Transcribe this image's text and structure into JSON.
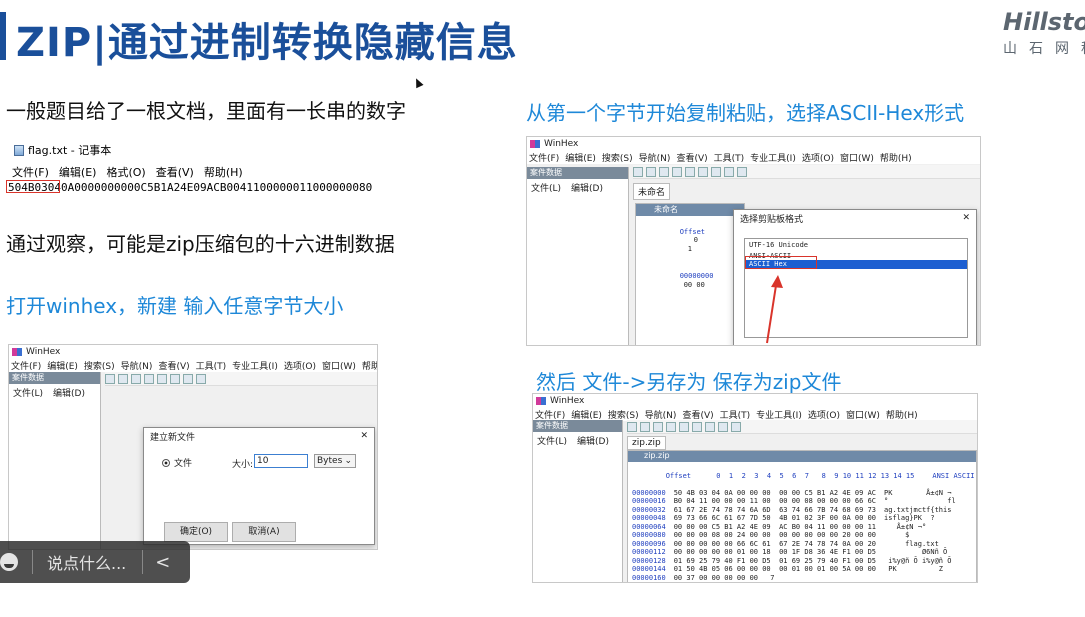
{
  "slide": {
    "title": "ZIP|通过进制转换隐藏信息",
    "logo_en": "Hillstone",
    "logo_cn": "山石网科"
  },
  "left": {
    "text1": "一般题目给了一根文档，里面有一长串的数字",
    "text2": "通过观察，可能是zip压缩包的十六进制数据",
    "text3": "打开winhex，新建 输入任意字节大小"
  },
  "notepad": {
    "title": "flag.txt - 记事本",
    "menu": [
      "文件(F)",
      "编辑(E)",
      "格式(O)",
      "查看(V)",
      "帮助(H)"
    ],
    "content": "504B03040A0000000000C5B1A24E09ACB0041100000011000000080"
  },
  "winhex_common": {
    "app_title": "WinHex",
    "menu": [
      "文件(F)",
      "编辑(E)",
      "搜索(S)",
      "导航(N)",
      "查看(V)",
      "工具(T)",
      "专业工具(I)",
      "选项(O)",
      "窗口(W)",
      "帮助(H)"
    ],
    "case_data": "案件数据",
    "file_tab": "文件(L)",
    "edit_tab": "编辑(D)"
  },
  "new_file_dialog": {
    "title": "建立新文件",
    "option_file": "文件",
    "size_label": "大小:",
    "size_value": "10",
    "unit": "Bytes",
    "ok": "确定(O)",
    "cancel": "取消(A)"
  },
  "right": {
    "text1": "从第一个字节开始复制粘贴，选择ASCII-Hex形式",
    "text2": "然后 文件->另存为  保存为zip文件"
  },
  "clipboard": {
    "doc_tab": "未命名",
    "inner_title": "未命名",
    "offset_header": "Offset",
    "col0": "0",
    "col1": "1",
    "offset_row": "00000000",
    "cells": "00 00",
    "dialog_title": "选择剪贴板格式",
    "options": [
      "UTF-16 Unicode",
      "ANSI-ASCII",
      "ASCII Hex"
    ]
  },
  "zipwin": {
    "doc_tab": "zip.zip",
    "inner_title": "zip.zip",
    "header": "Offset      0  1  2  3  4  5  6  7   8  9 10 11 12 13 14 15",
    "ascii_header": "ANSI ASCII",
    "rows": [
      {
        "off": "00000000",
        "hex": "50 4B 03 04 0A 00 00 00  00 00 C5 B1 A2 4E 09 AC",
        "asc": "PK        Å±¢N ¬"
      },
      {
        "off": "00000016",
        "hex": "B0 04 11 00 00 00 11 00  00 00 08 00 00 00 66 6C",
        "asc": "°              fl"
      },
      {
        "off": "00000032",
        "hex": "61 67 2E 74 78 74 6A 6D  63 74 66 7B 74 68 69 73",
        "asc": "ag.txtjmctf{this"
      },
      {
        "off": "00000048",
        "hex": "69 73 66 6C 61 67 7D 50  4B 01 02 3F 00 0A 00 00",
        "asc": "isflag}PK  ?"
      },
      {
        "off": "00000064",
        "hex": "00 00 00 C5 B1 A2 4E 09  AC B0 04 11 00 00 00 11",
        "asc": "   Å±¢N ¬°"
      },
      {
        "off": "00000080",
        "hex": "00 00 00 08 00 24 00 00  00 00 00 00 00 20 00 00",
        "asc": "     $"
      },
      {
        "off": "00000096",
        "hex": "00 00 00 00 00 66 6C 61  67 2E 74 78 74 0A 00 20",
        "asc": "     flag.txt"
      },
      {
        "off": "00000112",
        "hex": "00 00 00 00 00 01 00 18  00 1F D8 36 4E F1 00 D5",
        "asc": "         Ø6Nñ Õ"
      },
      {
        "off": "00000128",
        "hex": "01 69 25 79 40 F1 00 D5  01 69 25 79 40 F1 00 D5",
        "asc": " i%y@ñ Õ i%y@ñ Õ"
      },
      {
        "off": "00000144",
        "hex": "01 50 4B 05 06 00 00 00  00 01 00 01 00 5A 00 00",
        "asc": " PK          Z"
      },
      {
        "off": "00000160",
        "hex": "00 37 00 00 00 00 00",
        "asc": " 7"
      }
    ]
  },
  "chat": {
    "placeholder": "说点什么...",
    "collapse": "<"
  }
}
